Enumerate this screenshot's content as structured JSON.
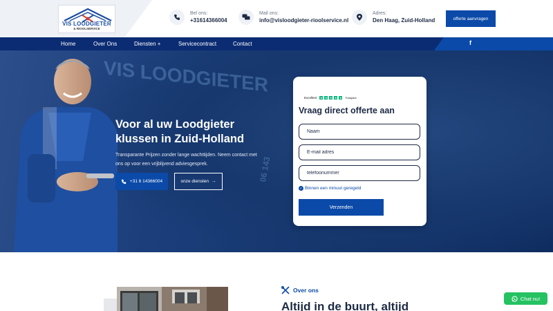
{
  "brand": {
    "logo_title": "VIS LOODGIETER",
    "logo_subtitle": "& RIOOLSERVICE"
  },
  "header": {
    "phone_label": "Bel ons:",
    "phone_value": "+31614366004",
    "mail_label": "Mail ons:",
    "mail_value": "info@visloodgieter-rioolservice.nl",
    "address_label": "Adres:",
    "address_value": "Den Haag, Zuid-Holland",
    "cta_label": "offerte aanvragen"
  },
  "nav": {
    "items": [
      {
        "label": "Home"
      },
      {
        "label": "Over Ons"
      },
      {
        "label": "Diensten +"
      },
      {
        "label": "Servicecontract"
      },
      {
        "label": "Contact"
      }
    ],
    "social_icon": "facebook-icon"
  },
  "hero": {
    "title": "Voor al uw Loodgieter klussen in Zuid-Holland",
    "subtitle": "Transparante Prijzen zonder lange wachttijden. Neem contact met ons op voor een vrijblijvend adviesgesprek.",
    "phone_button": "+31 6 14366004",
    "services_button": "onze diensten"
  },
  "form": {
    "trustpilot_label": "Excellent",
    "trustpilot_brand": "Trustpilot",
    "title": "Vraag direct offerte aan",
    "name_placeholder": "Naam",
    "email_placeholder": "E-mail adres",
    "phone_placeholder": "telefoonummer",
    "note": "Binnen een minuut geregeld",
    "submit_label": "Verzenden"
  },
  "about": {
    "tag": "Over ons",
    "heading": "Altijd in de buurt, altijd"
  },
  "chat": {
    "label": "Chat nu!"
  },
  "colors": {
    "primary": "#0b4aa8",
    "nav": "#0b2c73",
    "chat": "#25c262"
  }
}
